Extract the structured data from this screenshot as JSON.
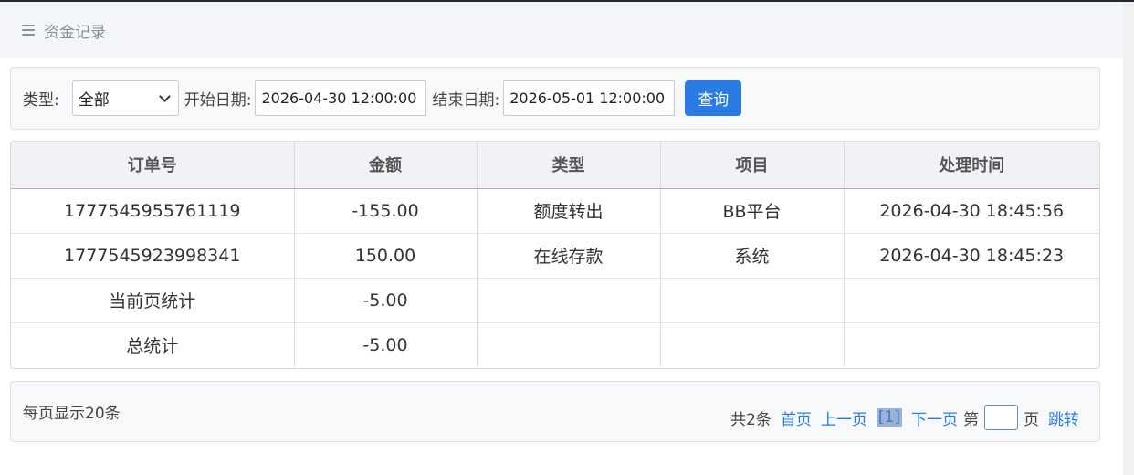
{
  "header": {
    "title": "资金记录",
    "icon": "menu-icon"
  },
  "filter": {
    "type_label": "类型:",
    "type_value": "全部",
    "start_label": "开始日期:",
    "start_value": "2026-04-30 12:00:00",
    "end_label": "结束日期:",
    "end_value": "2026-05-01 12:00:00",
    "query_button": "查询"
  },
  "table": {
    "headers": [
      "订单号",
      "金额",
      "类型",
      "项目",
      "处理时间"
    ],
    "rows": [
      [
        "1777545955761119",
        "-155.00",
        "额度转出",
        "BB平台",
        "2026-04-30 18:45:56"
      ],
      [
        "1777545923998341",
        "150.00",
        "在线存款",
        "系统",
        "2026-04-30 18:45:23"
      ],
      [
        "当前页统计",
        "-5.00",
        "",
        "",
        ""
      ],
      [
        "总统计",
        "-5.00",
        "",
        "",
        ""
      ]
    ]
  },
  "footer": {
    "per_page": "每页显示20条",
    "total": "共2条",
    "first": "首页",
    "prev": "上一页",
    "current": "[1]",
    "next": "下一页",
    "page_prefix": "第",
    "page_suffix": "页",
    "jump": "跳转"
  },
  "colors": {
    "accent": "#2a7be4",
    "header_bg": "#f4f6f9"
  }
}
